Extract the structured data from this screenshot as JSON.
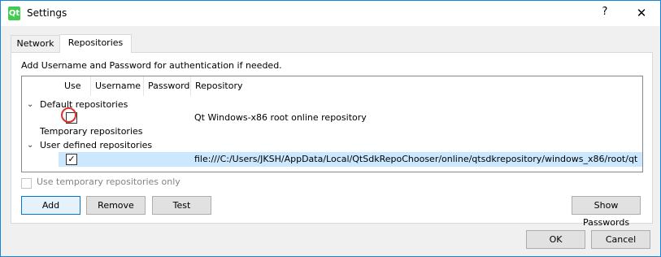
{
  "window": {
    "title": "Settings",
    "help_glyph": "?",
    "close_glyph": "✕",
    "icon_text": "Qt"
  },
  "tabs": [
    {
      "label": "Network"
    },
    {
      "label": "Repositories"
    }
  ],
  "info_text": "Add Username and Password for authentication if needed.",
  "tree": {
    "columns": [
      "Use",
      "Username",
      "Password",
      "Repository"
    ],
    "groups": [
      {
        "label": "Default repositories",
        "expanded": true
      },
      {
        "label": "Temporary repositories",
        "expanded": false
      },
      {
        "label": "User defined repositories",
        "expanded": true
      }
    ],
    "default_repo": {
      "use": false,
      "repository": "Qt Windows-x86 root online repository"
    },
    "user_repo": {
      "use": true,
      "repository": "file:///C:/Users/JKSH/AppData/Local/QtSdkRepoChooser/online/qtsdkrepository/windows_x86/root/qt"
    },
    "arrow_glyph": "⌄"
  },
  "temp_only_label": "Use temporary repositories only",
  "buttons": {
    "add": "Add",
    "remove": "Remove",
    "test": "Test",
    "show_passwords": "Show Passwords",
    "ok": "OK",
    "cancel": "Cancel"
  },
  "check_glyph": "✓",
  "colors": {
    "accent": "#1883d7",
    "selection": "#cce8ff",
    "highlight_circle": "#e0302e"
  }
}
